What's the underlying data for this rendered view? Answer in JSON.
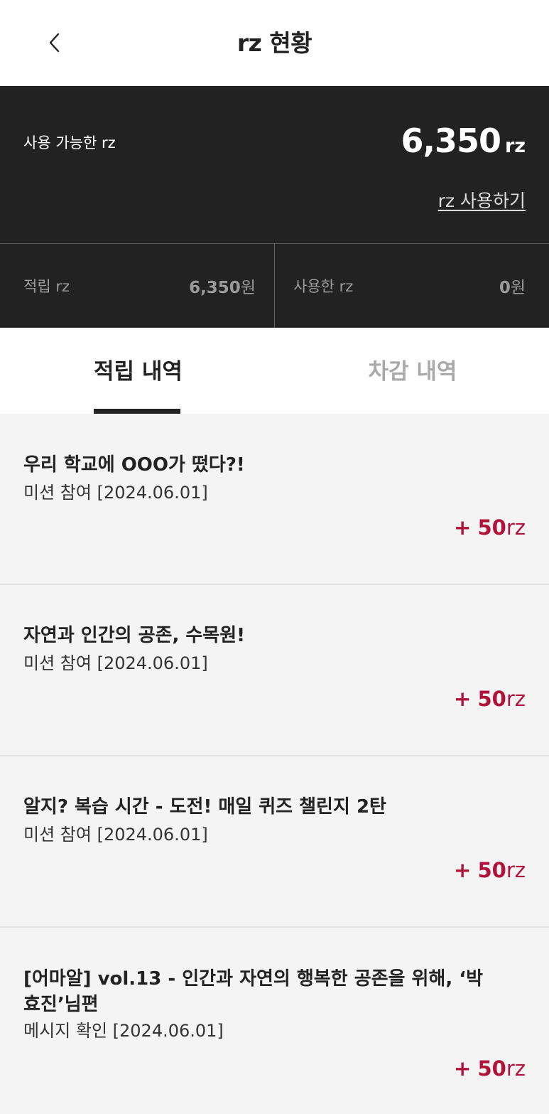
{
  "header": {
    "title": "rz 현황",
    "back_icon": "chevron-left-icon"
  },
  "summary": {
    "available_label": "사용 가능한 rz",
    "available_value": "6,350",
    "available_unit": "rz",
    "use_link": "rz 사용하기",
    "earned_label": "적립 rz",
    "earned_value": "6,350",
    "earned_unit": "원",
    "used_label": "사용한 rz",
    "used_value": "0",
    "used_unit": "원"
  },
  "tabs": [
    {
      "label": "적립 내역",
      "active": true
    },
    {
      "label": "차감 내역",
      "active": false
    }
  ],
  "items": [
    {
      "title": "우리 학교에 OOO가 떴다?!",
      "subtitle": "미션 참여 [2024.06.01]",
      "sign": "+",
      "amount": "50",
      "unit": "rz"
    },
    {
      "title": "자연과 인간의 공존, 수목원!",
      "subtitle": "미션 참여 [2024.06.01]",
      "sign": "+",
      "amount": "50",
      "unit": "rz"
    },
    {
      "title": "알지? 복습 시간 - 도전! 매일 퀴즈 챌린지 2탄",
      "subtitle": "미션 참여 [2024.06.01]",
      "sign": "+",
      "amount": "50",
      "unit": "rz"
    },
    {
      "title": "[어마알] vol.13 - 인간과 자연의 행복한 공존을 위해, ‘박효진’님편",
      "subtitle": "메시지 확인 [2024.06.01]",
      "sign": "+",
      "amount": "50",
      "unit": "rz"
    }
  ],
  "colors": {
    "dark_panel": "#222222",
    "reward": "#b0123c",
    "list_bg": "#f4f4f4"
  }
}
